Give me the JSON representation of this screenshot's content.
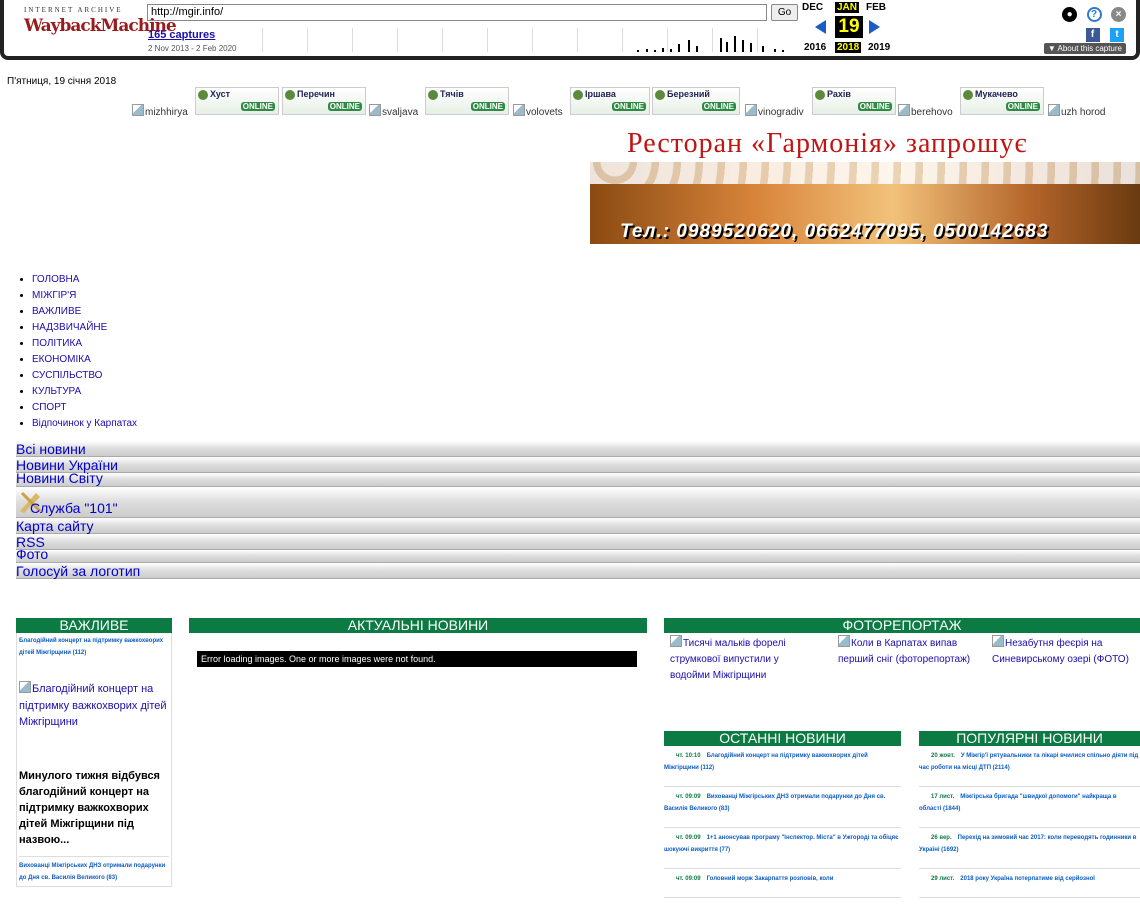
{
  "wayback": {
    "logo_top": "INTERNET ARCHIVE",
    "logo_main": "WaybackMachine",
    "url": "http://mgir.info/",
    "go": "Go",
    "captures": "165 captures",
    "range": "2 Nov 2013 - 2 Feb 2020",
    "months": [
      "DEC",
      "JAN",
      "FEB"
    ],
    "day": "19",
    "years": [
      "2016",
      "2018",
      "2019"
    ],
    "about": "▼ About this capture"
  },
  "site": {
    "date": "П'ятниця, 19 січня 2018",
    "partners": [
      {
        "type": "broken",
        "alt": "mizhhirya"
      },
      {
        "type": "banner",
        "text": "Хуст"
      },
      {
        "type": "banner",
        "text": "Перечин"
      },
      {
        "type": "broken",
        "alt": "svaljava"
      },
      {
        "type": "banner",
        "text": "Тячів"
      },
      {
        "type": "broken",
        "alt": "volovets"
      },
      {
        "type": "banner",
        "text": "Іршава"
      },
      {
        "type": "banner",
        "text": "Березний"
      },
      {
        "type": "broken",
        "alt": "vinogradiv"
      },
      {
        "type": "banner",
        "text": "Рахів"
      },
      {
        "type": "broken",
        "alt": "berehovo"
      },
      {
        "type": "banner",
        "text": "Мукачево"
      },
      {
        "type": "broken",
        "alt": "uzh horod"
      }
    ],
    "partner_badge": "ONLINE",
    "ad": {
      "title": "Ресторан «Гармонія» запрошує",
      "phones": "Тел.: 0989520620, 0662477095, 0500142683"
    },
    "menu": [
      "ГОЛОВНА",
      "МІЖГІР'Я",
      "ВАЖЛИВЕ",
      "НАДЗВИЧАЙНЕ",
      "ПОЛІТИКА",
      "ЕКОНОМІКА",
      "СУСПІЛЬСТВО",
      "КУЛЬТУРА",
      "СПОРТ",
      "Відпочинок у Карпатах"
    ],
    "bars": [
      "Всі новини",
      "Новини України",
      "Новини Світу",
      "Служба \"101\"",
      "Карта сайту",
      "RSS",
      "Фото",
      "Голосуй за логотип"
    ]
  },
  "important": {
    "header": "ВАЖЛИВЕ",
    "item1": "Благодійний концерт на підтримку важкохворих дітей Міжгірщини (112)",
    "img_alt": "Благодійний концерт на підтримку важкохворих дітей Міжгірщини",
    "lead": "Минулого тижня відбувся благодійний концерт на підтримку важкохворих дітей Міжгірщини під назвою...",
    "item2": "Вихованці Міжгірських ДНЗ отримали подарунки до Дня св. Василія Великого (83)"
  },
  "actual": {
    "header": "АКТУАЛЬНІ НОВИНИ",
    "error": "Error loading images. One or more images were not found."
  },
  "photo_report": {
    "header": "ФОТОРЕПОРТАЖ",
    "items": [
      "Тисячі мальків форелі струмкової випустили у водойми Міжгірщини",
      "Коли в Карпатах випав перший сніг (фоторепортаж)",
      "Незабутня феєрія на Синевирському озері (ФОТО)"
    ]
  },
  "latest": {
    "header": "ОСТАННІ НОВИНИ",
    "items": [
      {
        "time": "чт. 10:10",
        "text": "Благодійний концерт на підтримку важкохворих дітей Міжгірщини (112)"
      },
      {
        "time": "чт. 09:09",
        "text": "Вихованці Міжгірських ДНЗ отримали подарунки до Дня св. Василія Великого (83)"
      },
      {
        "time": "чт. 09:09",
        "text": "1+1 анонсував програму \"Інспектор. Міста\" в Ужгороді та обіцяє шокуючі викриття (77)"
      },
      {
        "time": "чт. 09:09",
        "text": "Головний морж Закарпаття розповів, коли"
      }
    ]
  },
  "popular": {
    "header": "ПОПУЛЯРНІ НОВИНИ",
    "items": [
      {
        "time": "20 жовт.",
        "text": "У Міжгір'ї рятувальники та лікарі вчилися спільно діяти під час роботи на місці ДТП (2114)"
      },
      {
        "time": "17 лист.",
        "text": "Міжгірська бригада \"швидкої допомоги\" найкраща в області (1844)"
      },
      {
        "time": "26 вер.",
        "text": "Перехід на зимовий час 2017: коли переводять годинники в Україні (1692)"
      },
      {
        "time": "29 лист.",
        "text": "2018 року Україна потерпатиме від серйозної"
      }
    ]
  }
}
